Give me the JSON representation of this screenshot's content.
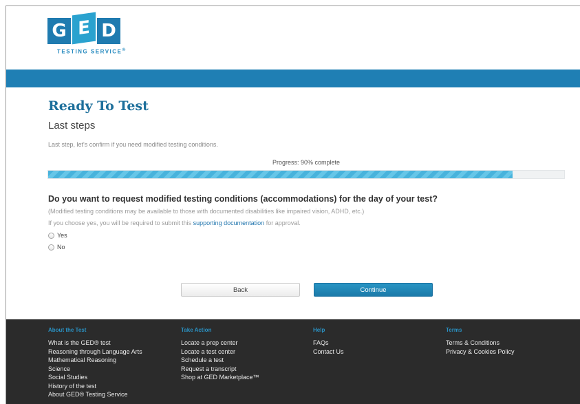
{
  "brand": {
    "letters": [
      "G",
      "E",
      "D"
    ],
    "tagline": "TESTING SERVICE",
    "tagline_mark": "®"
  },
  "page": {
    "title": "Ready To Test",
    "subtitle": "Last steps",
    "intro": "Last step, let's confirm if you need modified testing conditions."
  },
  "progress": {
    "label": "Progress: 90% complete",
    "percent": 90
  },
  "question": {
    "text": "Do you want to request modified testing conditions (accommodations) for the day of your test?",
    "note1": "(Modified testing conditions may be available to those with documented disabilities like impaired vision, ADHD, etc.)",
    "note2_before": "If you choose yes, you will be required to submit this ",
    "note2_link": "supporting documentation",
    "note2_after": " for approval.",
    "options": [
      "Yes",
      "No"
    ],
    "selected": null
  },
  "actions": {
    "back_label": "Back",
    "continue_label": "Continue"
  },
  "footer": {
    "columns": [
      {
        "heading": "About the Test",
        "links": [
          "What is the GED® test",
          "Reasoning through Language Arts",
          "Mathematical Reasoning",
          "Science",
          "Social Studies",
          "History of the test",
          "About GED® Testing Service"
        ]
      },
      {
        "heading": "Take Action",
        "links": [
          "Locate a prep center",
          "Locate a test center",
          "Schedule a test",
          "Request a transcript",
          "Shop at GED Marketplace™"
        ]
      },
      {
        "heading": "Help",
        "links": [
          "FAQs",
          "Contact Us"
        ]
      },
      {
        "heading": "Terms",
        "links": [
          "Terms & Conditions",
          "Privacy & Cookies Policy"
        ]
      }
    ]
  },
  "colors": {
    "brand_blue": "#1f7fb4",
    "title_blue": "#1d6f9b",
    "progress_fill": "#48b3dc",
    "footer_bg": "#2b2b2b",
    "footer_heading": "#2a91c2"
  }
}
